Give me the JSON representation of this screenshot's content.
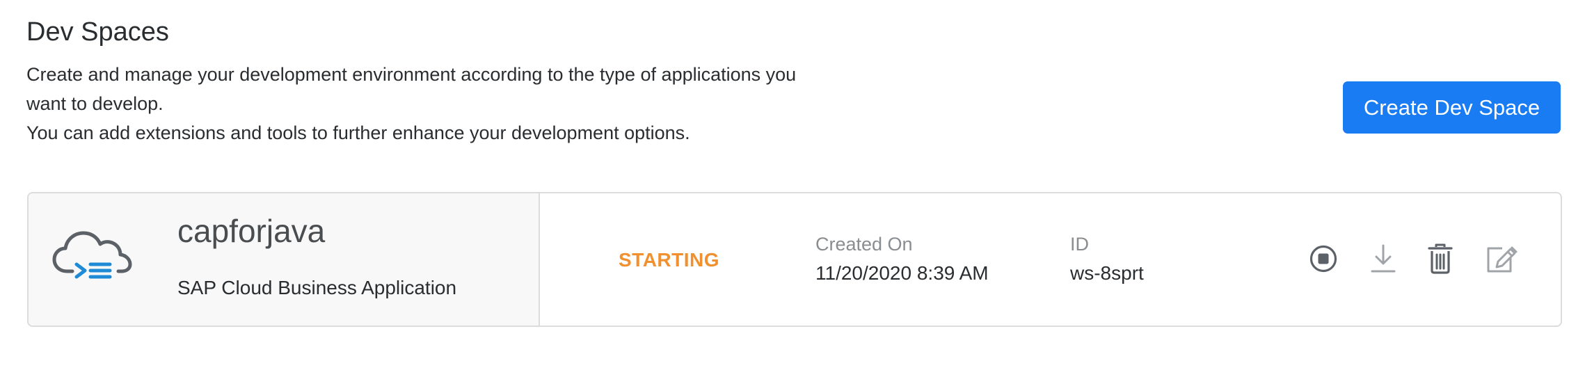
{
  "header": {
    "title": "Dev Spaces",
    "description_line1": "Create and manage your development environment according to the type of applications you",
    "description_line2": "want to develop.",
    "description_line3": "You can add extensions and tools to further enhance your development options.",
    "create_button_label": "Create Dev Space"
  },
  "workspace": {
    "icon": "cloud-terminal-icon",
    "name": "capforjava",
    "type": "SAP Cloud Business Application",
    "status": "STARTING",
    "created_on_label": "Created On",
    "created_on_value": "11/20/2020 8:39 AM",
    "id_label": "ID",
    "id_value": "ws-8sprt",
    "actions": [
      "stop-icon",
      "download-icon",
      "delete-icon",
      "edit-icon"
    ]
  },
  "colors": {
    "accent": "#1a7cf2",
    "status_starting": "#f0902f",
    "icon_gray": "#5b6167",
    "icon_blue": "#1f8bd6"
  }
}
